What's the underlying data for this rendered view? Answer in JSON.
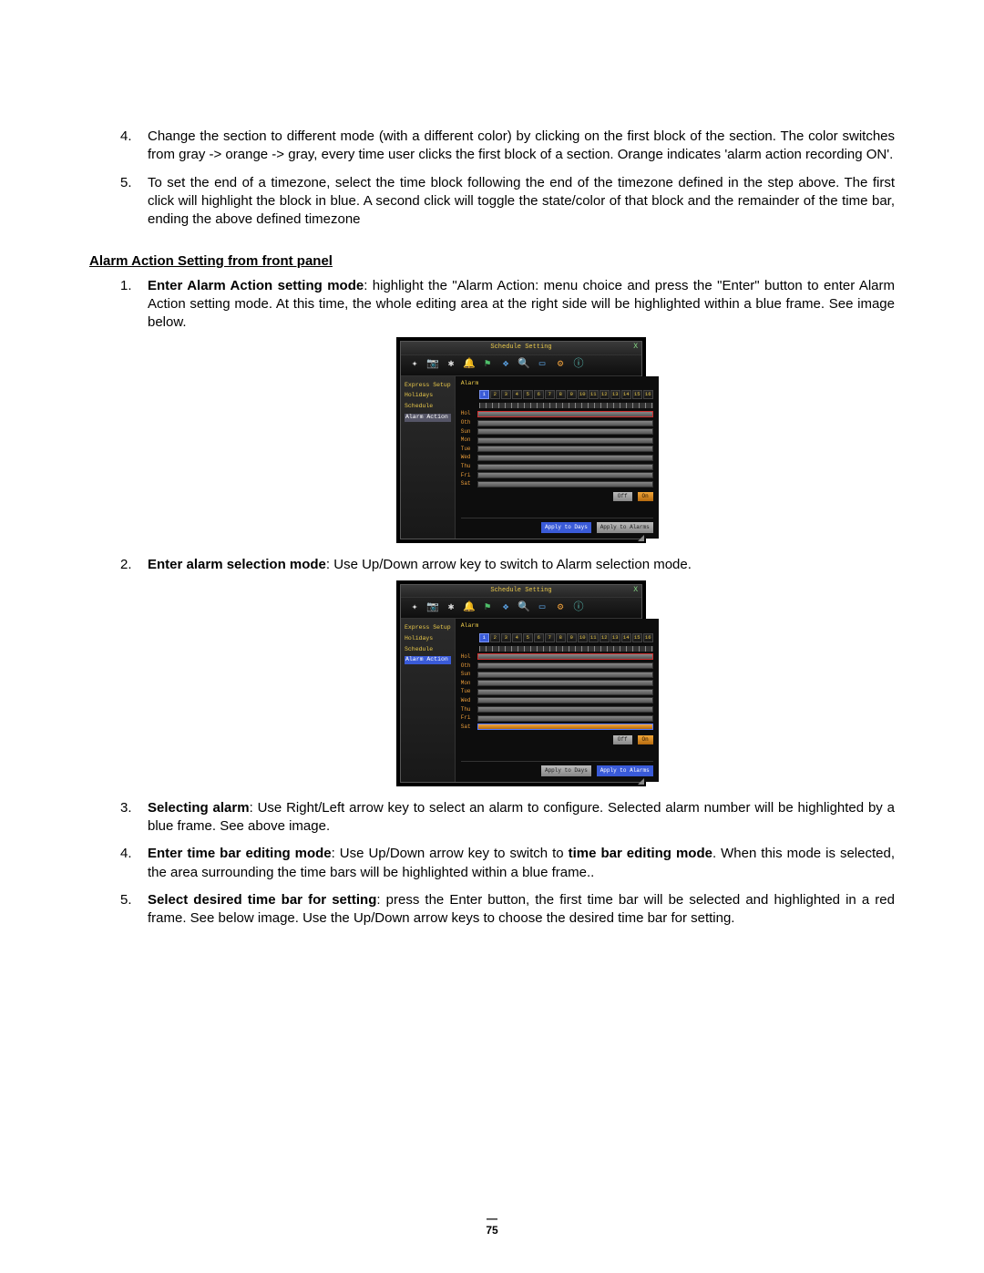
{
  "top_list": [
    {
      "num": "4.",
      "text": "Change the section to different mode (with a different color) by clicking on the first block of the section. The color switches from gray -> orange -> gray, every time user clicks the first block of a section. Orange indicates 'alarm action recording ON'."
    },
    {
      "num": "5.",
      "text": "To set the end of a timezone, select the time block following the end of the timezone defined in the step above. The first click will highlight the block in blue. A second click will toggle the state/color of that block and the remainder of the time bar, ending the above defined timezone"
    }
  ],
  "section_heading": "Alarm Action Setting from front panel",
  "steps": [
    {
      "num": "1.",
      "bold": "Enter Alarm Action setting mode",
      "rest": ": highlight the \"Alarm Action: menu choice and press the \"Enter\" button to enter Alarm Action setting mode. At this time, the whole editing area at the right side will be highlighted within a blue frame. See image below."
    },
    {
      "num": "2.",
      "bold": "Enter alarm selection mode",
      "rest": ": Use Up/Down arrow key to switch to Alarm selection mode."
    },
    {
      "num": "3.",
      "bold": "Selecting alarm",
      "rest": ": Use Right/Left arrow key to select an alarm to configure. Selected alarm number will be highlighted by a blue frame. See above image."
    },
    {
      "num": "4.",
      "bold": "Enter time bar editing mode",
      "mid": ": Use Up/Down arrow key to switch to ",
      "bold2": "time bar editing mode",
      "rest": ". When this mode is selected, the area surrounding the time bars will be highlighted within a blue frame.."
    },
    {
      "num": "5.",
      "bold": "Select desired time bar for setting",
      "rest": ": press the Enter button, the first time bar will be selected and highlighted in a red frame. See below image. Use the Up/Down arrow keys to choose the desired time bar for setting."
    }
  ],
  "page_number": "75",
  "dvr": {
    "title": "Schedule Setting",
    "close": "X",
    "sidebar": [
      "Express Setup",
      "Holidays",
      "Schedule",
      "Alarm Action"
    ],
    "alarm_label": "Alarm",
    "alarm_numbers": [
      "1",
      "2",
      "3",
      "4",
      "5",
      "6",
      "7",
      "8",
      "9",
      "10",
      "11",
      "12",
      "13",
      "14",
      "15",
      "16"
    ],
    "days": [
      "Hol",
      "Oth",
      "Sun",
      "Mon",
      "Tue",
      "Wed",
      "Thu",
      "Fri",
      "Sat"
    ],
    "legend_off": "Off",
    "legend_on": "On",
    "apply_days": "Apply to Days",
    "apply_alarms": "Apply to Alarms"
  }
}
